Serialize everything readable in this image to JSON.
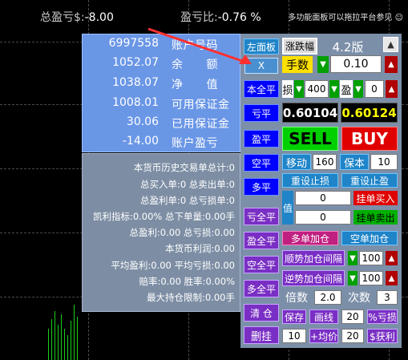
{
  "header": {
    "total_profit_label": "总盈亏$:",
    "total_profit_value": "-8.00",
    "profit_ratio_label": "盈亏比:",
    "profit_ratio_value": "-0.76 %",
    "right_notice": "多功能面板可以拖拉平台参见"
  },
  "account": {
    "rows": [
      {
        "value": "6997558",
        "label": "账户号码"
      },
      {
        "value": "1052.07",
        "label": "余　　额"
      },
      {
        "value": "1038.07",
        "label": "净　　值"
      },
      {
        "value": "1008.01",
        "label": "可用保证金"
      },
      {
        "value": "30.06",
        "label": "已用保证金"
      },
      {
        "value": "-14.00",
        "label": "账户盈亏"
      }
    ]
  },
  "stats": {
    "lines": [
      "本货币历史交易单总计:0",
      "总买入单:0 总卖出单:0",
      "总盈利单:0  总亏损单:0",
      "凯利指标:0.00% 总下单量:0.00手",
      "总盈利:0.00  总亏损:0.00",
      "本货币利润:0.00",
      "平均盈利:0.00  平均亏损:0.00",
      "赔率:0.00  胜率:0.00%",
      "最大持仓限制:0.00手"
    ]
  },
  "controls": {
    "left_panel": "左面板",
    "rise_fall": "涨跌幅",
    "version": "4.2版",
    "up_arrow": "▲",
    "close_x": "X",
    "lots_label": "手数",
    "lots_value": "0.10",
    "close_all": "本全平",
    "stoploss_label": "损",
    "stoploss_value": "400",
    "takeprofit_label": "盈",
    "takeprofit_value": "0",
    "close_loss": "亏平",
    "bid": "0.60104",
    "ask": "0.60124",
    "close_profit": "盈平",
    "sell": "SELL",
    "buy": "BUY",
    "close_short": "空平",
    "move_label": "移动",
    "move_value": "160",
    "breakeven_label": "保本",
    "breakeven_value": "10",
    "close_long": "多平",
    "reset_stoploss": "重设止损",
    "reset_takeprofit": "重设止盈",
    "close_loss_all": "亏全平",
    "price_label": "值",
    "pending_buy": "挂单买入",
    "pending_value_1": "0",
    "pending_value_2": "0",
    "pending_sell": "挂单卖出",
    "close_profit_all": "盈全平",
    "add_long": "多单加仓",
    "add_short": "空单加仓",
    "close_short_all": "空全平",
    "trend_add_label": "顺势加仓间隔",
    "trend_add_value": "100",
    "close_long_all": "多全平",
    "counter_add_label": "逆势加仓间隔",
    "counter_add_value": "100",
    "multiplier_label": "倍数",
    "multiplier_value": "2.0",
    "times_label": "次数",
    "times_value": "3",
    "close_all_positions": "清 仓",
    "save": "保存",
    "draw_line": "画线",
    "percent_value": "20",
    "percent_loss": "%亏损",
    "delete_pending": "删挂",
    "avg_value": "10",
    "avg_label": "+均价",
    "profit_value": "20",
    "dollar_profit": "$获利",
    "down_arrow": "▼",
    "up_small": "▲"
  },
  "colors": {
    "account_bg": "#6a96e6",
    "stats_bg": "#7d8ea4",
    "panel_bg": "#7c8fa8",
    "bid_color": "#ffffff",
    "ask_color": "#ffff00",
    "sell_bg": "#00d000",
    "buy_bg": "#e00000"
  }
}
